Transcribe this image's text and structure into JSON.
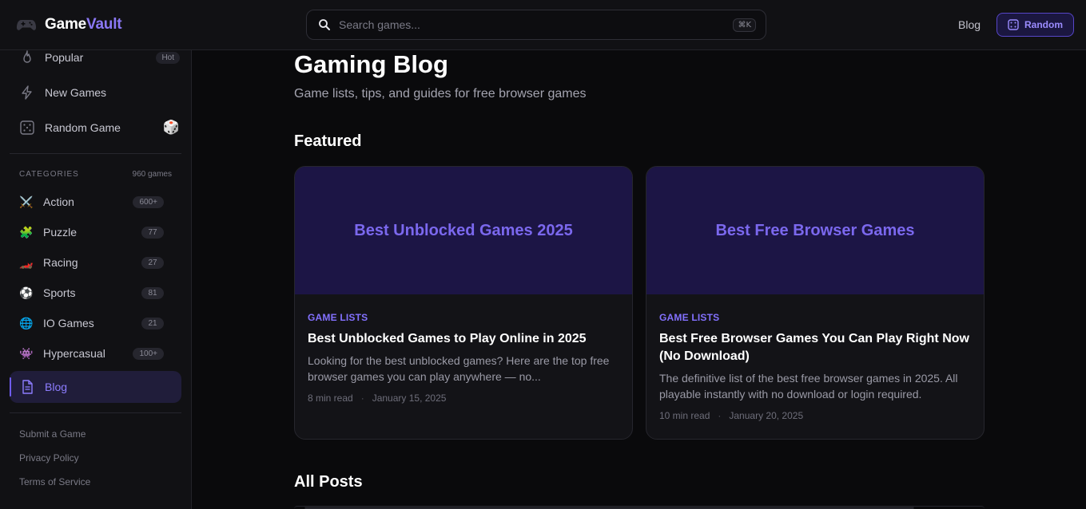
{
  "header": {
    "logo_part1": "Game",
    "logo_part2": "Vault",
    "search_placeholder": "Search games...",
    "search_shortcut": "⌘K",
    "nav_blog": "Blog",
    "random_label": "Random"
  },
  "sidebar": {
    "top_items": [
      {
        "label": "Popular",
        "badge": "Hot"
      },
      {
        "label": "New Games"
      },
      {
        "label": "Random Game",
        "emoji": "🎲"
      }
    ],
    "categories_title": "CATEGORIES",
    "categories_count": "960 games",
    "categories": [
      {
        "emoji": "⚔️",
        "label": "Action",
        "count": "600+"
      },
      {
        "emoji": "🧩",
        "label": "Puzzle",
        "count": "77"
      },
      {
        "emoji": "🏎️",
        "label": "Racing",
        "count": "27"
      },
      {
        "emoji": "⚽",
        "label": "Sports",
        "count": "81"
      },
      {
        "emoji": "🌐",
        "label": "IO Games",
        "count": "21"
      },
      {
        "emoji": "👾",
        "label": "Hypercasual",
        "count": "100+"
      }
    ],
    "active_item": "Blog",
    "footer_links": [
      "Submit a Game",
      "Privacy Policy",
      "Terms of Service"
    ]
  },
  "main": {
    "title": "Gaming Blog",
    "subtitle": "Game lists, tips, and guides for free browser games",
    "featured_title": "Featured",
    "all_posts_title": "All Posts",
    "featured": [
      {
        "hero": "Best Unblocked Games 2025",
        "category": "GAME LISTS",
        "title": "Best Unblocked Games to Play Online in 2025",
        "description": "Looking for the best unblocked games? Here are the top free browser games you can play anywhere — no...",
        "read_time": "8 min read",
        "date": "January 15, 2025"
      },
      {
        "hero": "Best Free Browser Games",
        "category": "GAME LISTS",
        "title": "Best Free Browser Games You Can Play Right Now (No Download)",
        "description": "The definitive list of the best free browser games in 2025. All playable instantly with no download or login required.",
        "read_time": "10 min read",
        "date": "January 20, 2025"
      }
    ]
  },
  "colors": {
    "accent": "#7b68ee",
    "background": "#0a0a0c",
    "panel": "#111114",
    "hero": "#1c1545"
  }
}
